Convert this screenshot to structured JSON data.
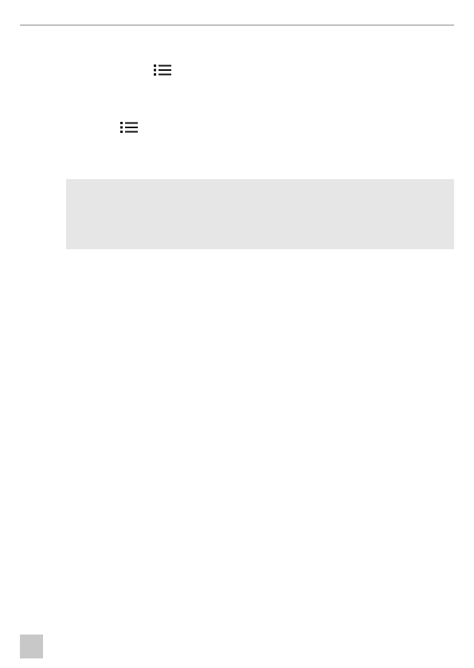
{
  "icons": [
    {
      "name": "list-icon",
      "glyph": "list-bullets"
    },
    {
      "name": "list-icon",
      "glyph": "list-bullets"
    }
  ],
  "colors": {
    "rule": "#8a8a8a",
    "note_box": "#e6e6e6",
    "page_tab": "#c8c8c8",
    "icon": "#111111"
  }
}
